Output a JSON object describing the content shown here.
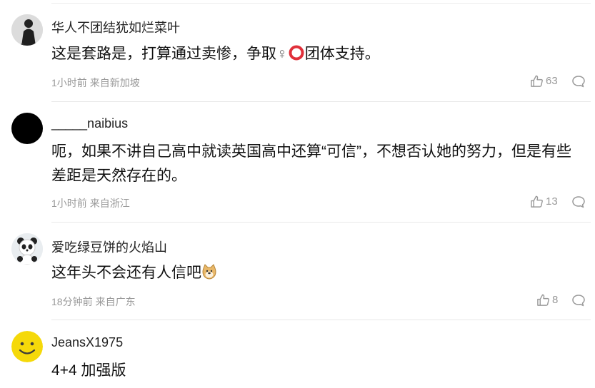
{
  "comments": [
    {
      "user": "华人不团结犹如烂菜叶",
      "content_parts": [
        "这是套路是，打算通过卖惨，争取",
        "♀",
        "",
        "团体支持。"
      ],
      "time": "1小时前",
      "location": "来自新加坡",
      "likes": "63",
      "avatar_icon": "person-in-dark-clothes-avatar"
    },
    {
      "user": "_____naibius",
      "content": "呃，如果不讲自己高中就读英国高中还算“可信”，不想否认她的努力，但是有些差距是天然存在的。",
      "time": "1小时前",
      "location": "来自浙江",
      "likes": "13",
      "avatar_icon": "black-circle-avatar"
    },
    {
      "user": "爱吃绿豆饼的火焰山",
      "content": "这年头不会还有人信吧",
      "time": "18分钟前",
      "location": "来自广东",
      "likes": "8",
      "avatar_icon": "panda-avatar"
    },
    {
      "user": "JeansX1975",
      "content": "4+4 加强版",
      "avatar_icon": "smiley-face-avatar"
    }
  ],
  "colors": {
    "text": "#111111",
    "meta": "#999999",
    "ring_emoji": "#e0303a",
    "smiley": "#f5d90a"
  },
  "icons": [
    "thumbs-up-icon",
    "comment-bubble-icon",
    "female-sign-emoji",
    "red-ring-emoji",
    "doge-emoji"
  ]
}
